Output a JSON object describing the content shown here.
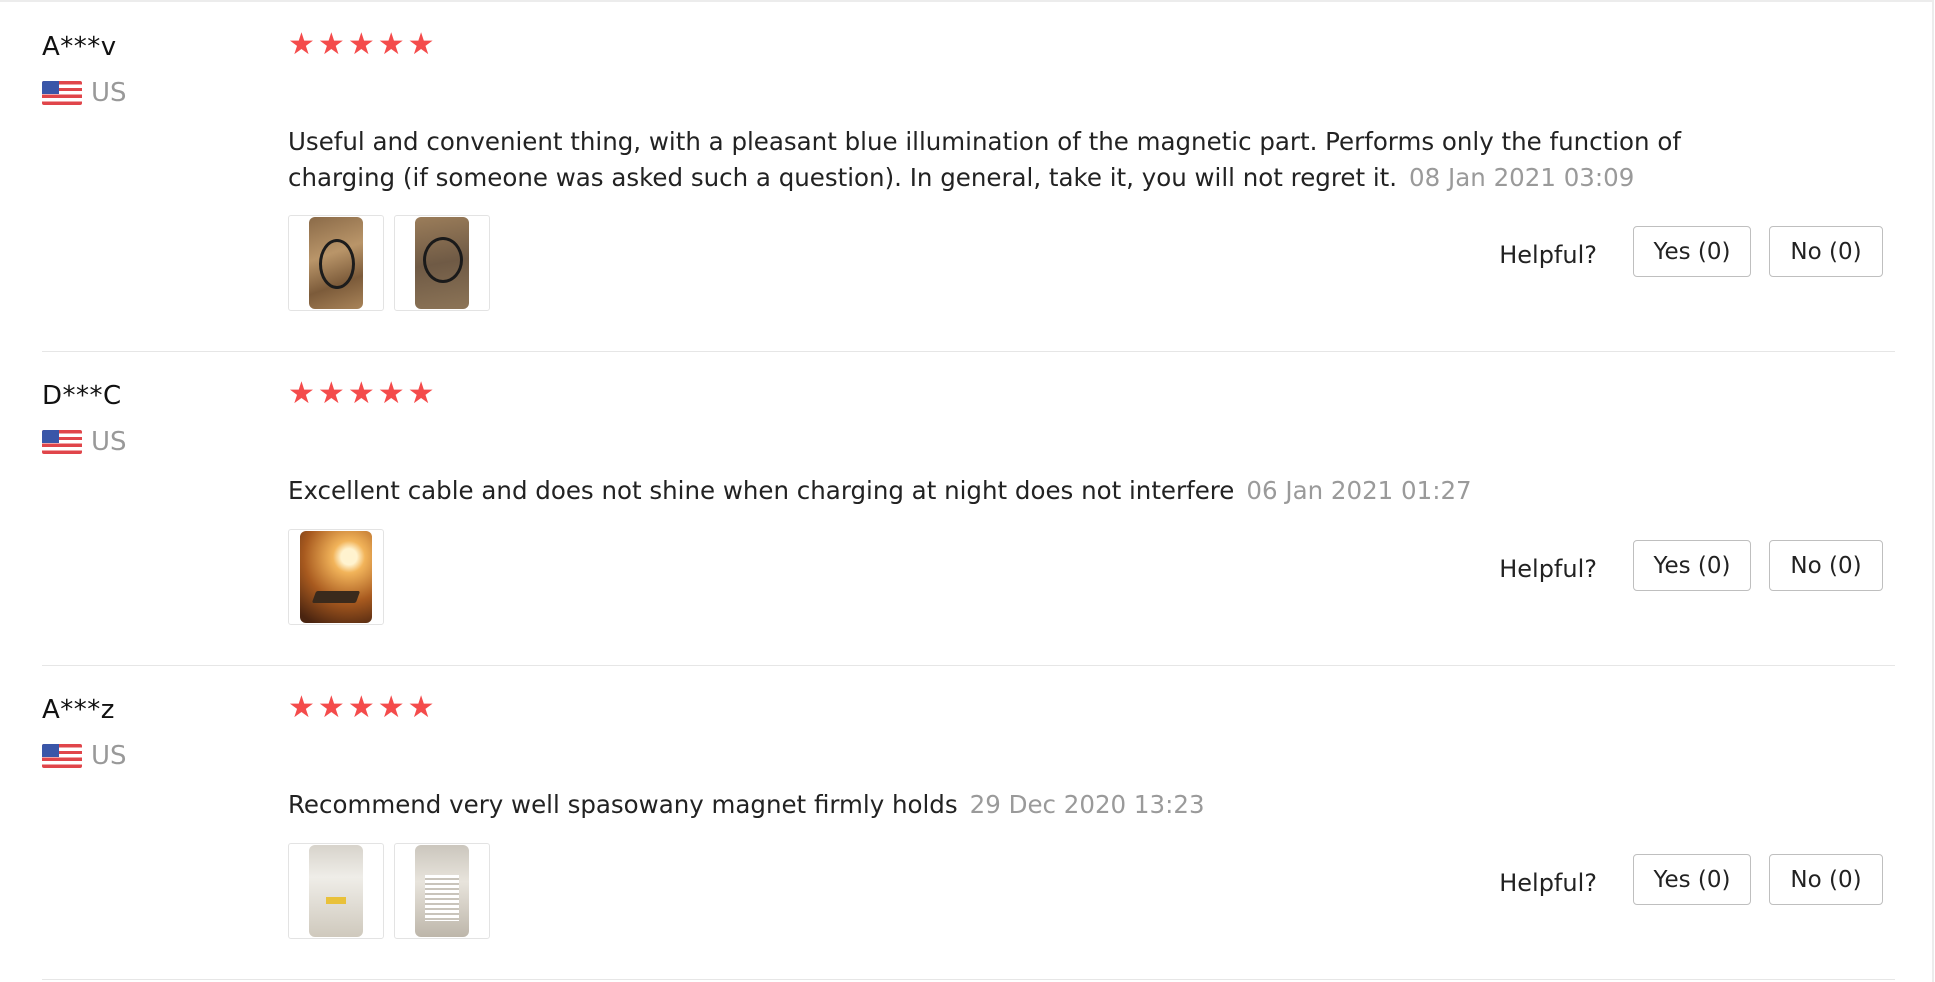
{
  "helpful_label": "Helpful?",
  "colors": {
    "star": "#f44b4b",
    "date": "#9a9a9a",
    "country": "#999999"
  },
  "reviews": [
    {
      "reviewer": "A***v",
      "country": "US",
      "rating": 5,
      "text": "Useful and convenient thing, with a pleasant blue illumination of the magnetic part. Performs only the function of charging (if someone was asked such a question). In general, take it, you will not regret it.",
      "date": "08 Jan 2021 03:09",
      "photos": 2,
      "yes_label": "Yes (0)",
      "no_label": "No (0)"
    },
    {
      "reviewer": "D***C",
      "country": "US",
      "rating": 5,
      "text": "Excellent cable and does not shine when charging at night does not interfere",
      "date": "06 Jan 2021 01:27",
      "photos": 1,
      "yes_label": "Yes (0)",
      "no_label": "No (0)"
    },
    {
      "reviewer": "A***z",
      "country": "US",
      "rating": 5,
      "text": "Recommend very well spasowany magnet firmly holds",
      "date": "29 Dec 2020 13:23",
      "photos": 2,
      "yes_label": "Yes (0)",
      "no_label": "No (0)"
    }
  ]
}
